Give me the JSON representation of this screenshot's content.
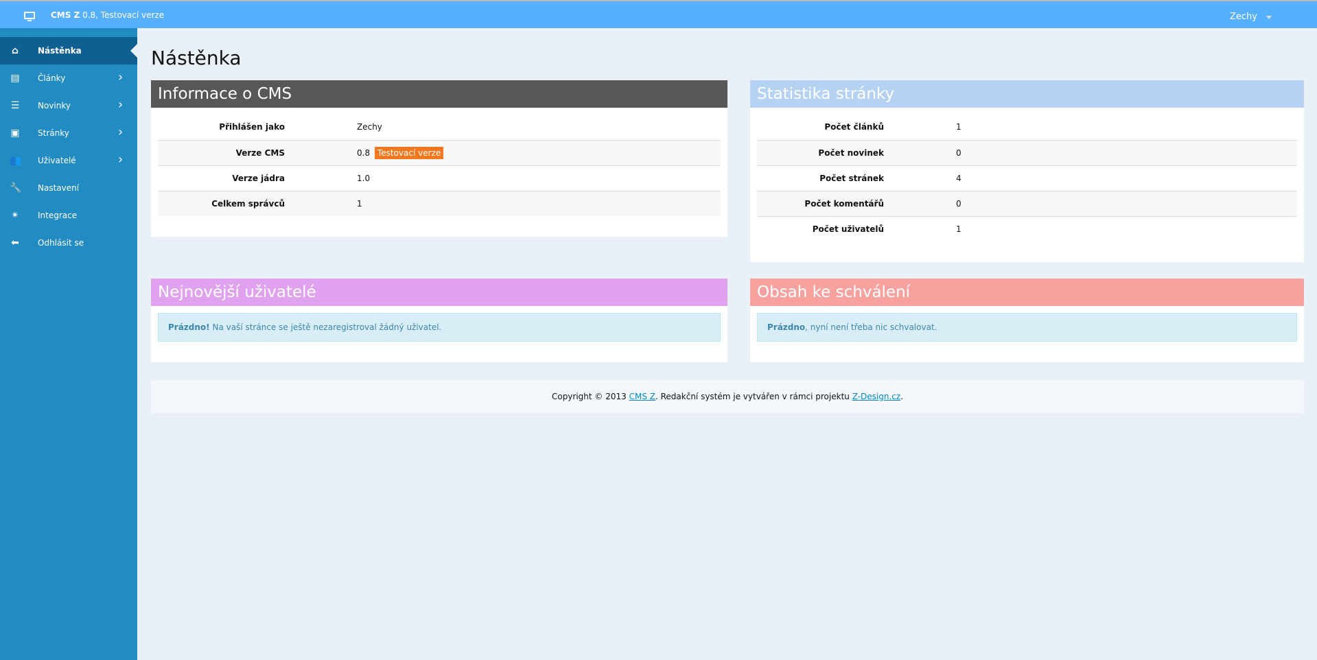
{
  "topbar": {
    "title_bold": "CMS Z",
    "title_rest": " 0.8, Testovací verze",
    "user": "Zechy"
  },
  "sidebar": {
    "items": [
      {
        "label": "Nástěnka",
        "icon": "home-icon",
        "active": true
      },
      {
        "label": "Články",
        "icon": "articles-icon",
        "chevron": true
      },
      {
        "label": "Novinky",
        "icon": "list-icon",
        "chevron": true
      },
      {
        "label": "Stránky",
        "icon": "page-icon",
        "chevron": true
      },
      {
        "label": "Uživatelé",
        "icon": "users-icon",
        "chevron": true
      },
      {
        "label": "Nastavení",
        "icon": "wrench-icon"
      },
      {
        "label": "Integrace",
        "icon": "magic-icon"
      },
      {
        "label": "Odhlásit se",
        "icon": "arrow-left-icon"
      }
    ]
  },
  "page_title": "Nástěnka",
  "info": {
    "title": "Informace o CMS",
    "color": "#575757",
    "rows": [
      {
        "k": "Přihlášen jako",
        "v": "Zechy"
      },
      {
        "k": "Verze CMS",
        "v": "0.8",
        "badge": "Testovací verze"
      },
      {
        "k": "Verze jádra",
        "v": "1.0"
      },
      {
        "k": "Celkem správců",
        "v": "1"
      }
    ]
  },
  "stats": {
    "title": "Statistika stránky",
    "color": "#b6d2f3",
    "rows": [
      {
        "k": "Počet článků",
        "v": "1"
      },
      {
        "k": "Počet novinek",
        "v": "0"
      },
      {
        "k": "Počet stránek",
        "v": "4"
      },
      {
        "k": "Počet komentářů",
        "v": "0"
      },
      {
        "k": "Počet uživatelů",
        "v": "1"
      }
    ]
  },
  "newest_users": {
    "title": "Nejnovější uživatelé",
    "color": "#e0a2ef",
    "alert_bold": "Prázdno!",
    "alert_text": " Na vaší stránce se ještě nezaregistroval žádný uživatel."
  },
  "approval": {
    "title": "Obsah ke schválení",
    "color": "#f7a29f",
    "alert_bold": "Prázdno",
    "alert_text": ", nyní není třeba nic schvalovat."
  },
  "footer": {
    "pre": "Copyright © 2013 ",
    "link1": "CMS Z",
    "mid": ". Redakční systém je vytvářen v rámci projektu ",
    "link2": "Z-Design.cz",
    "post": "."
  }
}
